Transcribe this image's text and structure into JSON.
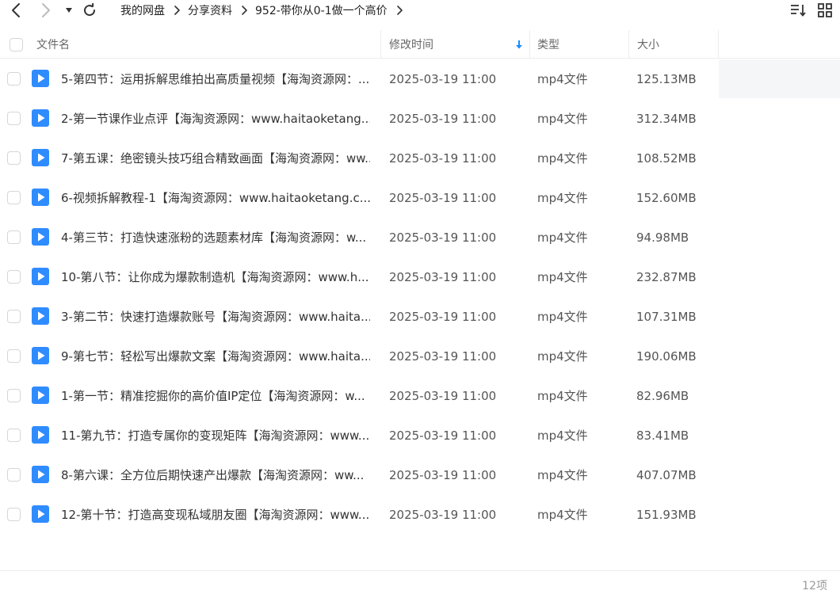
{
  "nav": {
    "back_icon": "chevron-left-icon",
    "forward_icon": "chevron-right-icon",
    "dropdown_icon": "caret-down-icon",
    "refresh_icon": "refresh-icon"
  },
  "breadcrumb": [
    "我的网盘",
    "分享资料",
    "952-带你从0-1做一个高价"
  ],
  "toolbar": {
    "sort_icon": "sort-list-icon",
    "view_icon": "grid-view-icon"
  },
  "columns": {
    "name": "文件名",
    "modified": "修改时间",
    "type": "类型",
    "size": "大小",
    "sort_direction": "descending"
  },
  "colors": {
    "accent": "#1a8cff",
    "file_icon": "#2f8cff"
  },
  "files": [
    {
      "name": "5-第四节：运用拆解思维拍出高质量视频【海淘资源网：...",
      "modified": "2025-03-19 11:00",
      "type": "mp4文件",
      "size": "125.13MB",
      "icon": "video-file-icon",
      "hovered": true
    },
    {
      "name": "2-第一节课作业点评【海淘资源网：www.haitaoketang...",
      "modified": "2025-03-19 11:00",
      "type": "mp4文件",
      "size": "312.34MB",
      "icon": "video-file-icon"
    },
    {
      "name": "7-第五课：绝密镜头技巧组合精致画面【海淘资源网：ww...",
      "modified": "2025-03-19 11:00",
      "type": "mp4文件",
      "size": "108.52MB",
      "icon": "video-file-icon"
    },
    {
      "name": "6-视频拆解教程-1【海淘资源网：www.haitaoketang.c...",
      "modified": "2025-03-19 11:00",
      "type": "mp4文件",
      "size": "152.60MB",
      "icon": "video-file-icon"
    },
    {
      "name": "4-第三节：打造快速涨粉的选题素材库【海淘资源网：w...",
      "modified": "2025-03-19 11:00",
      "type": "mp4文件",
      "size": "94.98MB",
      "icon": "video-file-icon"
    },
    {
      "name": "10-第八节：让你成为爆款制造机【海淘资源网：www.h...",
      "modified": "2025-03-19 11:00",
      "type": "mp4文件",
      "size": "232.87MB",
      "icon": "video-file-icon"
    },
    {
      "name": "3-第二节：快速打造爆款账号【海淘资源网：www.haita...",
      "modified": "2025-03-19 11:00",
      "type": "mp4文件",
      "size": "107.31MB",
      "icon": "video-file-icon"
    },
    {
      "name": "9-第七节：轻松写出爆款文案【海淘资源网：www.haita...",
      "modified": "2025-03-19 11:00",
      "type": "mp4文件",
      "size": "190.06MB",
      "icon": "video-file-icon"
    },
    {
      "name": "1-第一节：精准挖掘你的高价值IP定位【海淘资源网：w...",
      "modified": "2025-03-19 11:00",
      "type": "mp4文件",
      "size": "82.96MB",
      "icon": "video-file-icon"
    },
    {
      "name": "11-第九节：打造专属你的变现矩阵【海淘资源网：www...",
      "modified": "2025-03-19 11:00",
      "type": "mp4文件",
      "size": "83.41MB",
      "icon": "video-file-icon"
    },
    {
      "name": "8-第六课：全方位后期快速产出爆款【海淘资源网：ww...",
      "modified": "2025-03-19 11:00",
      "type": "mp4文件",
      "size": "407.07MB",
      "icon": "video-file-icon"
    },
    {
      "name": "12-第十节：打造高变现私域朋友圈【海淘资源网：www...",
      "modified": "2025-03-19 11:00",
      "type": "mp4文件",
      "size": "151.93MB",
      "icon": "video-file-icon"
    }
  ],
  "footer": {
    "item_count": "12项"
  }
}
